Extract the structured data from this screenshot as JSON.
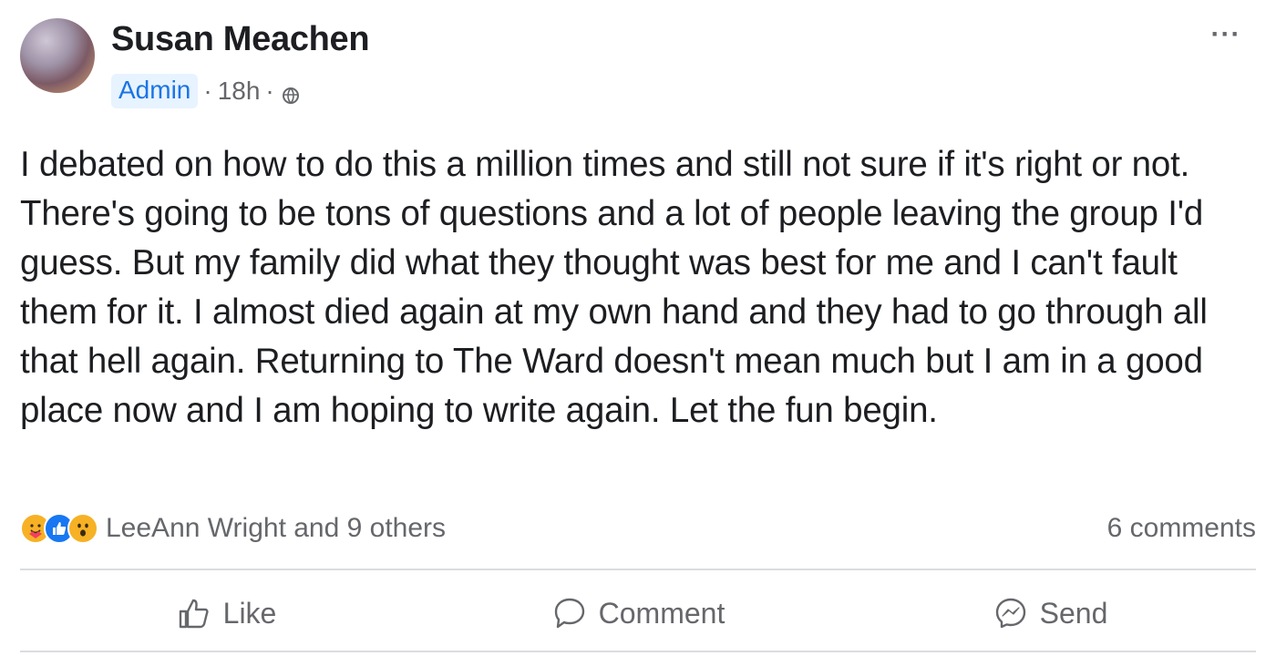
{
  "post": {
    "author": "Susan Meachen",
    "badge": "Admin",
    "time": "18h",
    "separator": "·",
    "more_label": "···",
    "privacy_icon": "globe-icon",
    "body": "I debated on how to do this a million times and still not sure if it's right or not. There's going to be tons of questions and a lot of people leaving the group I'd guess. But my family did what they thought was best for me and I can't fault them for it. I almost died again at my own hand and they had to go through all that hell again. Returning to The Ward doesn't mean much but I am in a good place now and I am hoping to write again. Let the fun begin."
  },
  "reactions": {
    "icons": [
      "care-reaction-icon",
      "like-reaction-icon",
      "wow-reaction-icon"
    ],
    "summary": "LeeAnn Wright and 9 others",
    "comments": "6 comments"
  },
  "actions": {
    "like": "Like",
    "comment": "Comment",
    "send": "Send"
  },
  "colors": {
    "badge_bg": "#e7f3ff",
    "badge_text": "#1b74e4",
    "secondary_text": "#65676b",
    "like_blue": "#1877f2",
    "reaction_yellow": "#f7b125"
  }
}
